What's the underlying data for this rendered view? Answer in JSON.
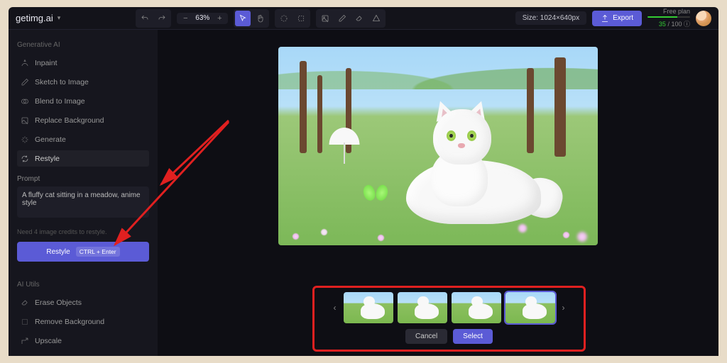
{
  "brand": "getimg.ai",
  "toolbar": {
    "zoom": "63%",
    "size_label": "Size: 1024×640px",
    "export_label": "Export"
  },
  "plan": {
    "label": "Free plan",
    "used": "35",
    "total": "100"
  },
  "sidebar": {
    "section1_title": "Generative AI",
    "items": [
      {
        "label": "Inpaint"
      },
      {
        "label": "Sketch to Image"
      },
      {
        "label": "Blend to Image"
      },
      {
        "label": "Replace Background"
      },
      {
        "label": "Generate"
      },
      {
        "label": "Restyle"
      }
    ],
    "prompt_label": "Prompt",
    "prompt_value": "A fluffy cat sitting in a meadow, anime style",
    "credits_note": "Need 4 image credits to restyle.",
    "restyle_label": "Restyle",
    "restyle_kbd": "CTRL + Enter",
    "section2_title": "AI Utils",
    "utils": [
      {
        "label": "Erase Objects"
      },
      {
        "label": "Remove Background"
      },
      {
        "label": "Upscale"
      }
    ]
  },
  "results": {
    "cancel_label": "Cancel",
    "select_label": "Select"
  }
}
